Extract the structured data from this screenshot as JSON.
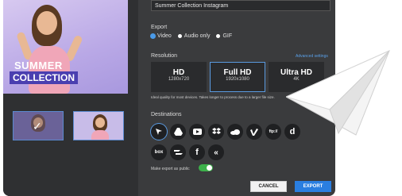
{
  "export_dialog": {
    "title_value": "Summer Collection Instagram",
    "export_label": "Export",
    "formats": [
      "Video",
      "Audio only",
      "GIF"
    ],
    "selected_format": "Video",
    "resolution_label": "Resolution",
    "advanced_label": "Advanced settings",
    "resolutions": [
      {
        "name": "HD",
        "dims": "1280x720"
      },
      {
        "name": "Full HD",
        "dims": "1920x1080"
      },
      {
        "name": "Ultra HD",
        "dims": "4K"
      }
    ],
    "selected_resolution": "Full HD",
    "resolution_note": "Ideal quality for most devices. Takes longer to process due to a larger file size.",
    "destinations_label": "Destinations",
    "destinations_row1": [
      "cursor",
      "drive",
      "youtube",
      "dropbox",
      "onedrive",
      "vimeo",
      "ftp://",
      "d"
    ],
    "destinations_row2": [
      "box",
      "wrike",
      "f",
      "k"
    ],
    "destination_text": {
      "ftp": "ftp://",
      "d": "d",
      "box": "box",
      "f": "f",
      "k": "«"
    },
    "public_label": "Make export as public",
    "public_enabled": true,
    "cancel_label": "CANCEL",
    "export_button": "EXPORT"
  },
  "preview": {
    "line1": "SUMMER",
    "line2": "COLLECTION"
  },
  "colors": {
    "accent": "#2a7ee0",
    "toggle_on": "#3cb04a",
    "panel": "#3a3b3d"
  }
}
